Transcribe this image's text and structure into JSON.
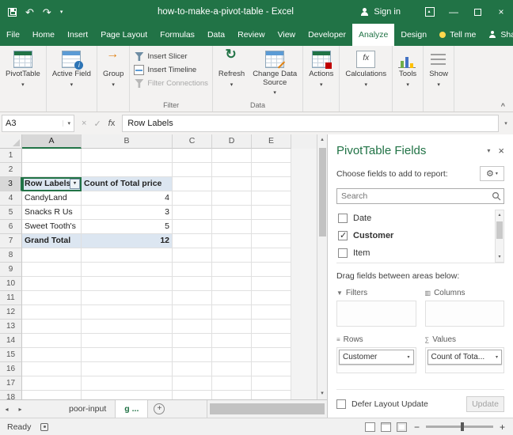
{
  "colors": {
    "accent": "#217346",
    "pivot_header_fill": "#dce6f1"
  },
  "titlebar": {
    "title": "how-to-make-a-pivot-table - Excel",
    "sign_in": "Sign in"
  },
  "ribbon_tabs": [
    {
      "label": "File"
    },
    {
      "label": "Home"
    },
    {
      "label": "Insert"
    },
    {
      "label": "Page Layout"
    },
    {
      "label": "Formulas"
    },
    {
      "label": "Data"
    },
    {
      "label": "Review"
    },
    {
      "label": "View"
    },
    {
      "label": "Developer"
    },
    {
      "label": "Analyze",
      "active": true
    },
    {
      "label": "Design"
    },
    {
      "label": "Tell me",
      "icon": "lightbulb"
    },
    {
      "label": "Share",
      "icon": "person",
      "right": true
    }
  ],
  "ribbon": {
    "groups": [
      {
        "name": "pivottable",
        "large": [
          {
            "label": "PivotTable",
            "icon": "pivottable-icon",
            "dropdown": true
          }
        ]
      },
      {
        "name": "active-field",
        "large": [
          {
            "label": "Active Field",
            "icon": "active-field-icon",
            "dropdown": true
          }
        ]
      },
      {
        "name": "group",
        "large": [
          {
            "label": "Group",
            "icon": "group-icon",
            "dropdown": true
          }
        ]
      },
      {
        "name": "filter",
        "label": "Filter",
        "small": [
          {
            "label": "Insert Slicer",
            "icon": "slicer-icon"
          },
          {
            "label": "Insert Timeline",
            "icon": "timeline-icon"
          },
          {
            "label": "Filter Connections",
            "icon": "filter-connections-icon",
            "disabled": true
          }
        ]
      },
      {
        "name": "data",
        "label": "Data",
        "large": [
          {
            "label": "Refresh",
            "icon": "refresh-icon",
            "dropdown": true
          },
          {
            "label": "Change Data Source",
            "icon": "change-data-source-icon",
            "dropdown": true
          }
        ]
      },
      {
        "name": "actions",
        "large": [
          {
            "label": "Actions",
            "icon": "actions-icon",
            "dropdown": true
          }
        ]
      },
      {
        "name": "calculations",
        "large": [
          {
            "label": "Calculations",
            "icon": "calculations-icon",
            "dropdown": true
          }
        ]
      },
      {
        "name": "tools",
        "large": [
          {
            "label": "Tools",
            "icon": "tools-icon",
            "dropdown": true
          }
        ]
      },
      {
        "name": "show",
        "large": [
          {
            "label": "Show",
            "icon": "show-icon",
            "dropdown": true
          }
        ]
      }
    ]
  },
  "formula_bar": {
    "name_box": "A3",
    "formula": "Row Labels"
  },
  "grid": {
    "col_headers": [
      "A",
      "B",
      "C",
      "D",
      "E"
    ],
    "row_count": 18,
    "selected_cell": "A3",
    "selected_col": "A",
    "selected_row": 3,
    "rows": [
      {
        "r": 3,
        "cells": [
          {
            "c": "A",
            "v": "Row Labels",
            "style": "pivotHeader",
            "filter": true
          },
          {
            "c": "B",
            "v": "Count of Total price",
            "style": "pivotHeader"
          }
        ]
      },
      {
        "r": 4,
        "cells": [
          {
            "c": "A",
            "v": "CandyLand"
          },
          {
            "c": "B",
            "v": "4",
            "num": true
          }
        ]
      },
      {
        "r": 5,
        "cells": [
          {
            "c": "A",
            "v": "Snacks R Us"
          },
          {
            "c": "B",
            "v": "3",
            "num": true
          }
        ]
      },
      {
        "r": 6,
        "cells": [
          {
            "c": "A",
            "v": "Sweet Tooth's"
          },
          {
            "c": "B",
            "v": "5",
            "num": true
          }
        ]
      },
      {
        "r": 7,
        "cells": [
          {
            "c": "A",
            "v": "Grand Total",
            "style": "pivotTotal"
          },
          {
            "c": "B",
            "v": "12",
            "num": true,
            "style": "pivotTotal"
          }
        ]
      }
    ]
  },
  "fields_pane": {
    "title": "PivotTable Fields",
    "choose_fields_label": "Choose fields to add to report:",
    "search_placeholder": "Search",
    "fields": [
      {
        "label": "Date",
        "checked": false
      },
      {
        "label": "Customer",
        "checked": true
      },
      {
        "label": "Item",
        "checked": false
      }
    ],
    "drag_label": "Drag fields between areas below:",
    "areas": {
      "filters": {
        "label": "Filters",
        "items": []
      },
      "columns": {
        "label": "Columns",
        "items": []
      },
      "rows": {
        "label": "Rows",
        "items": [
          "Customer"
        ]
      },
      "values": {
        "label": "Values",
        "items": [
          "Count of Tota..."
        ]
      }
    },
    "defer_label": "Defer Layout Update",
    "update_label": "Update"
  },
  "sheet_bar": {
    "tabs": [
      {
        "label": "poor-input",
        "active": false
      },
      {
        "label": "g ...",
        "active": true
      }
    ]
  },
  "status_bar": {
    "ready": "Ready"
  }
}
